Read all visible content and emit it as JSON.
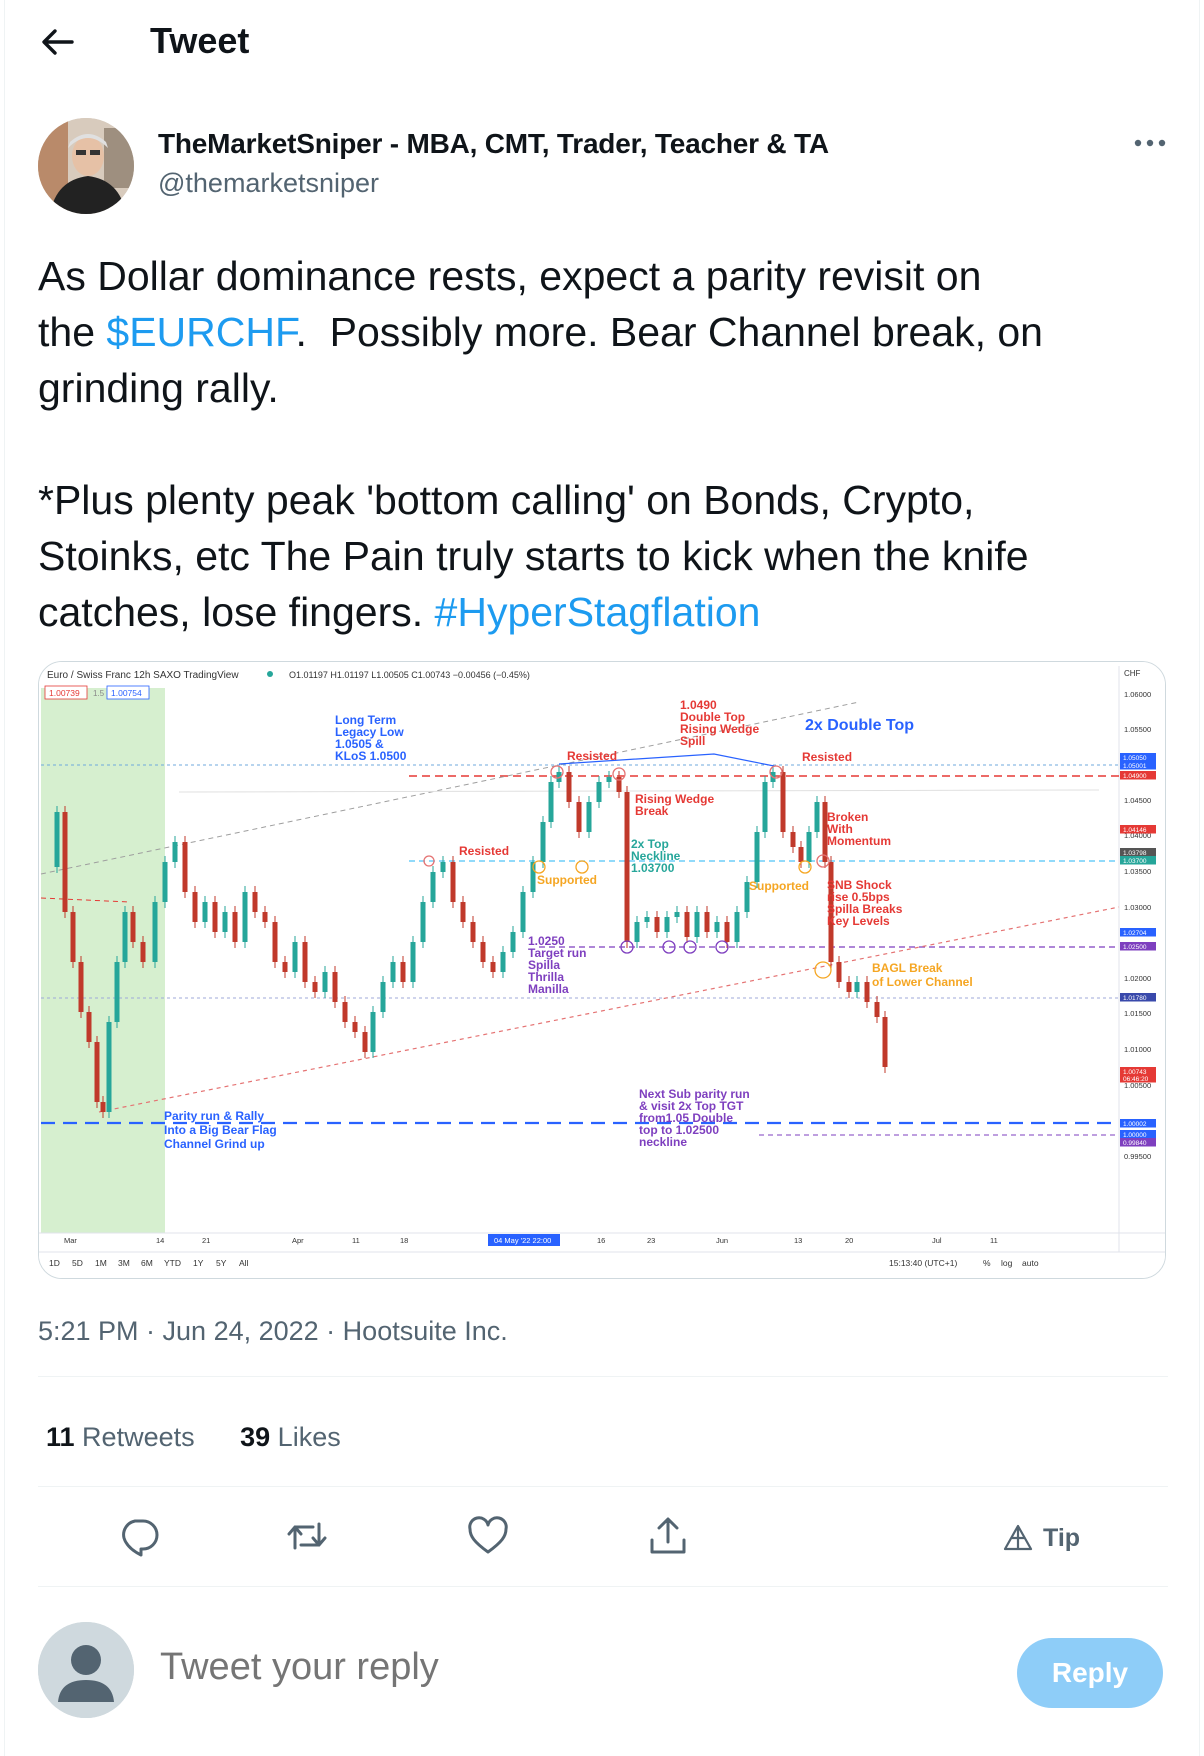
{
  "header": {
    "title": "Tweet"
  },
  "author": {
    "name": "TheMarketSniper - MBA, CMT, Trader, Teacher & TA",
    "handle": "@themarketsniper"
  },
  "tweet": {
    "line1_a": "As Dollar dominance rests, expect a parity revisit on",
    "line2_a": "the ",
    "cashtag": "$EURCHF",
    "line2_b": ".  Possibly more. Bear Channel break, on",
    "line3": "grinding rally.",
    "para2_a": "*Plus plenty peak 'bottom calling' on Bonds, Crypto,",
    "para2_b": "Stoinks, etc The Pain truly starts to kick when the knife",
    "para2_c": "catches, lose fingers. ",
    "hashtag": "#HyperStagflation"
  },
  "chart": {
    "header_symbol": "Euro / Swiss Franc  12h  SAXO  TradingView",
    "header_ohlc": "O1.01197 H1.01197 L1.00505 C1.00743 −0.00456 (−0.45%)",
    "bid": "1.00739",
    "spread": "1.5",
    "ask": "1.00754",
    "currency": "CHF",
    "x_labels": [
      "Mar",
      "14",
      "21",
      "Apr",
      "11",
      "18",
      "04 May '22  22:00",
      "16",
      "23",
      "Jun",
      "13",
      "20",
      "Jul",
      "11"
    ],
    "y_labels": [
      "1.06000",
      "1.05500",
      "1.04500",
      "1.04000",
      "1.03500",
      "1.03000",
      "1.02000",
      "1.01500",
      "1.01000",
      "1.00500",
      "0.99500"
    ],
    "price_tags": [
      {
        "label": "1.05050",
        "color": "#2962ff"
      },
      {
        "label": "1.05001",
        "color": "#2962ff"
      },
      {
        "label": "1.04900",
        "color": "#e53935"
      },
      {
        "label": "1.04146",
        "color": "#e53935"
      },
      {
        "label": "1.03798",
        "color": "#555555"
      },
      {
        "label": "1.03700",
        "color": "#26a69a"
      },
      {
        "label": "1.02704",
        "color": "#2962ff"
      },
      {
        "label": "1.02500",
        "color": "#7e3fbf"
      },
      {
        "label": "1.01780",
        "color": "#3949ab"
      },
      {
        "label": "1.00743",
        "color": "#e53935"
      },
      {
        "label": "06:46:20",
        "color": "#e53935"
      },
      {
        "label": "1.00002",
        "color": "#2962ff"
      },
      {
        "label": "1.00000",
        "color": "#2962ff"
      },
      {
        "label": "0.99840",
        "color": "#7e3fbf"
      }
    ],
    "annotations": {
      "long_term": [
        "Long Term",
        "Legacy Low",
        "1.0505 &",
        "KLoS 1.0500"
      ],
      "double_top_note": [
        "1.0490",
        "Double Top",
        "Rising Wedge",
        "Spill"
      ],
      "double_top_title": "2x Double Top",
      "resisted": "Resisted",
      "rising_wedge": [
        "Rising Wedge",
        "Break"
      ],
      "neckline": [
        "2x Top",
        "Neckline",
        "1.03700"
      ],
      "supported": "Supported",
      "broken": [
        "Broken",
        "With",
        "Momentum"
      ],
      "snb": [
        "SNB Shock",
        "rise 0.5bps",
        "Spilla Breaks",
        "Key Levels"
      ],
      "target": [
        "1.0250",
        "Target run",
        "Spilla",
        "Thrilla",
        "Manilla"
      ],
      "bagl": [
        "BAGL Break",
        "of Lower Channel"
      ],
      "parity": [
        "Parity run & Rally",
        "Into a Big Bear Flag",
        "Channel Grind up"
      ],
      "sub_parity": [
        "Next Sub parity run",
        "& visit 2x Top TGT",
        "from1.05 Double",
        "top to 1.02500",
        "neckline"
      ]
    },
    "timeframes": [
      "1D",
      "5D",
      "1M",
      "3M",
      "6M",
      "YTD",
      "1Y",
      "5Y",
      "All"
    ],
    "clock": "15:13:40 (UTC+1)",
    "scale_options": [
      "%",
      "log",
      "auto"
    ]
  },
  "meta": "5:21 PM · Jun 24, 2022 · Hootsuite Inc.",
  "stats": {
    "retweets_count": "11",
    "retweets_label": " Retweets",
    "likes_count": "39",
    "likes_label": " Likes"
  },
  "actions": {
    "tip_label": "Tip"
  },
  "reply": {
    "placeholder": "Tweet your reply",
    "button_label": "Reply"
  },
  "colors": {
    "accent": "#1d9bf0",
    "reply_button": "#8ecdf8"
  }
}
